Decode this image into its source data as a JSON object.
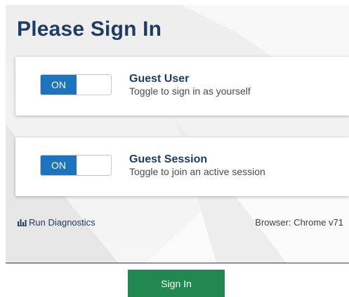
{
  "page": {
    "title": "Please Sign In"
  },
  "options": [
    {
      "toggle_label": "ON",
      "title": "Guest User",
      "subtitle": "Toggle to sign in as yourself"
    },
    {
      "toggle_label": "ON",
      "title": "Guest Session",
      "subtitle": "Toggle to join an active session"
    }
  ],
  "footer": {
    "diagnostics_label": "Run Diagnostics",
    "diagnostics_icon": "bar-chart-icon",
    "browser_info": "Browser: Chrome v71"
  },
  "actions": {
    "sign_in_label": "Sign In"
  },
  "colors": {
    "title": "#1f3b63",
    "toggle_on": "#1e73be",
    "sign_in_button": "#21894f"
  }
}
